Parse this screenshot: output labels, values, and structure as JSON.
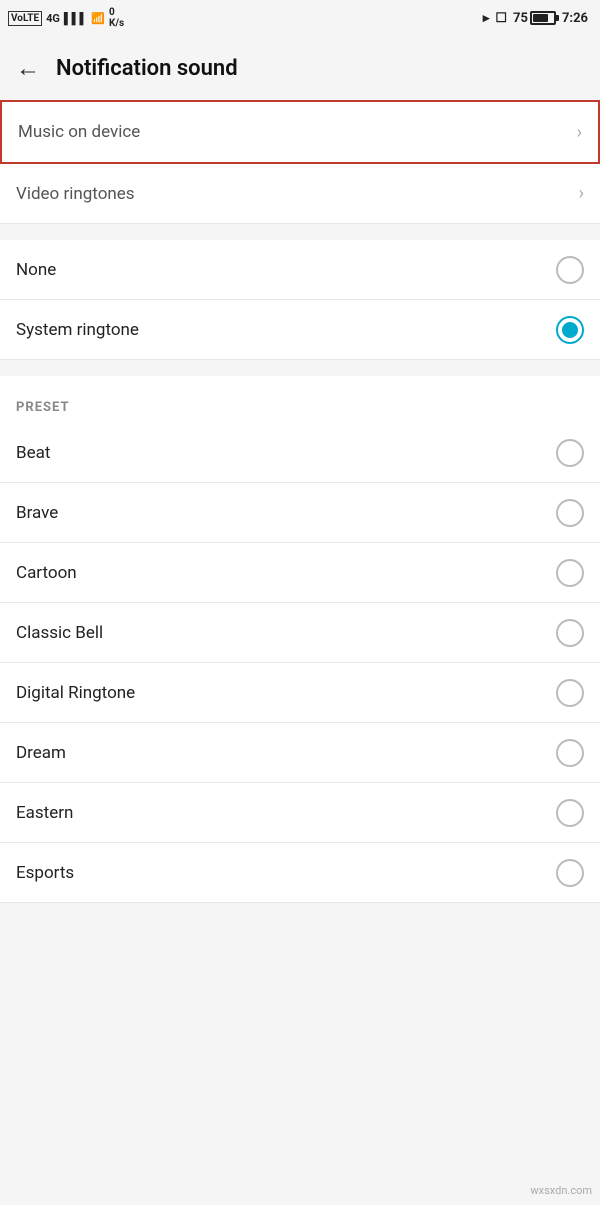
{
  "statusBar": {
    "left": {
      "volte": "VoLTE",
      "network": "4G",
      "signal": "▋▋▋",
      "wifi": "WiFi",
      "data": "0 K/s"
    },
    "right": {
      "bluetooth": "⚝",
      "vibrate": "⬚",
      "battery": "75",
      "time": "7:26"
    }
  },
  "header": {
    "back_label": "←",
    "title": "Notification sound"
  },
  "menuItems": [
    {
      "id": "music-on-device",
      "label": "Music on device",
      "type": "link",
      "highlighted": true
    },
    {
      "id": "video-ringtones",
      "label": "Video ringtones",
      "type": "link",
      "highlighted": false
    }
  ],
  "radioItems": [
    {
      "id": "none",
      "label": "None",
      "selected": false
    },
    {
      "id": "system-ringtone",
      "label": "System ringtone",
      "selected": true
    }
  ],
  "presetSection": {
    "header": "PRESET"
  },
  "presetItems": [
    {
      "id": "beat",
      "label": "Beat",
      "selected": false
    },
    {
      "id": "brave",
      "label": "Brave",
      "selected": false
    },
    {
      "id": "cartoon",
      "label": "Cartoon",
      "selected": false
    },
    {
      "id": "classic-bell",
      "label": "Classic Bell",
      "selected": false
    },
    {
      "id": "digital-ringtone",
      "label": "Digital Ringtone",
      "selected": false
    },
    {
      "id": "dream",
      "label": "Dream",
      "selected": false
    },
    {
      "id": "eastern",
      "label": "Eastern",
      "selected": false
    },
    {
      "id": "esports",
      "label": "Esports",
      "selected": false
    }
  ],
  "watermark": "wxsxdn.com"
}
